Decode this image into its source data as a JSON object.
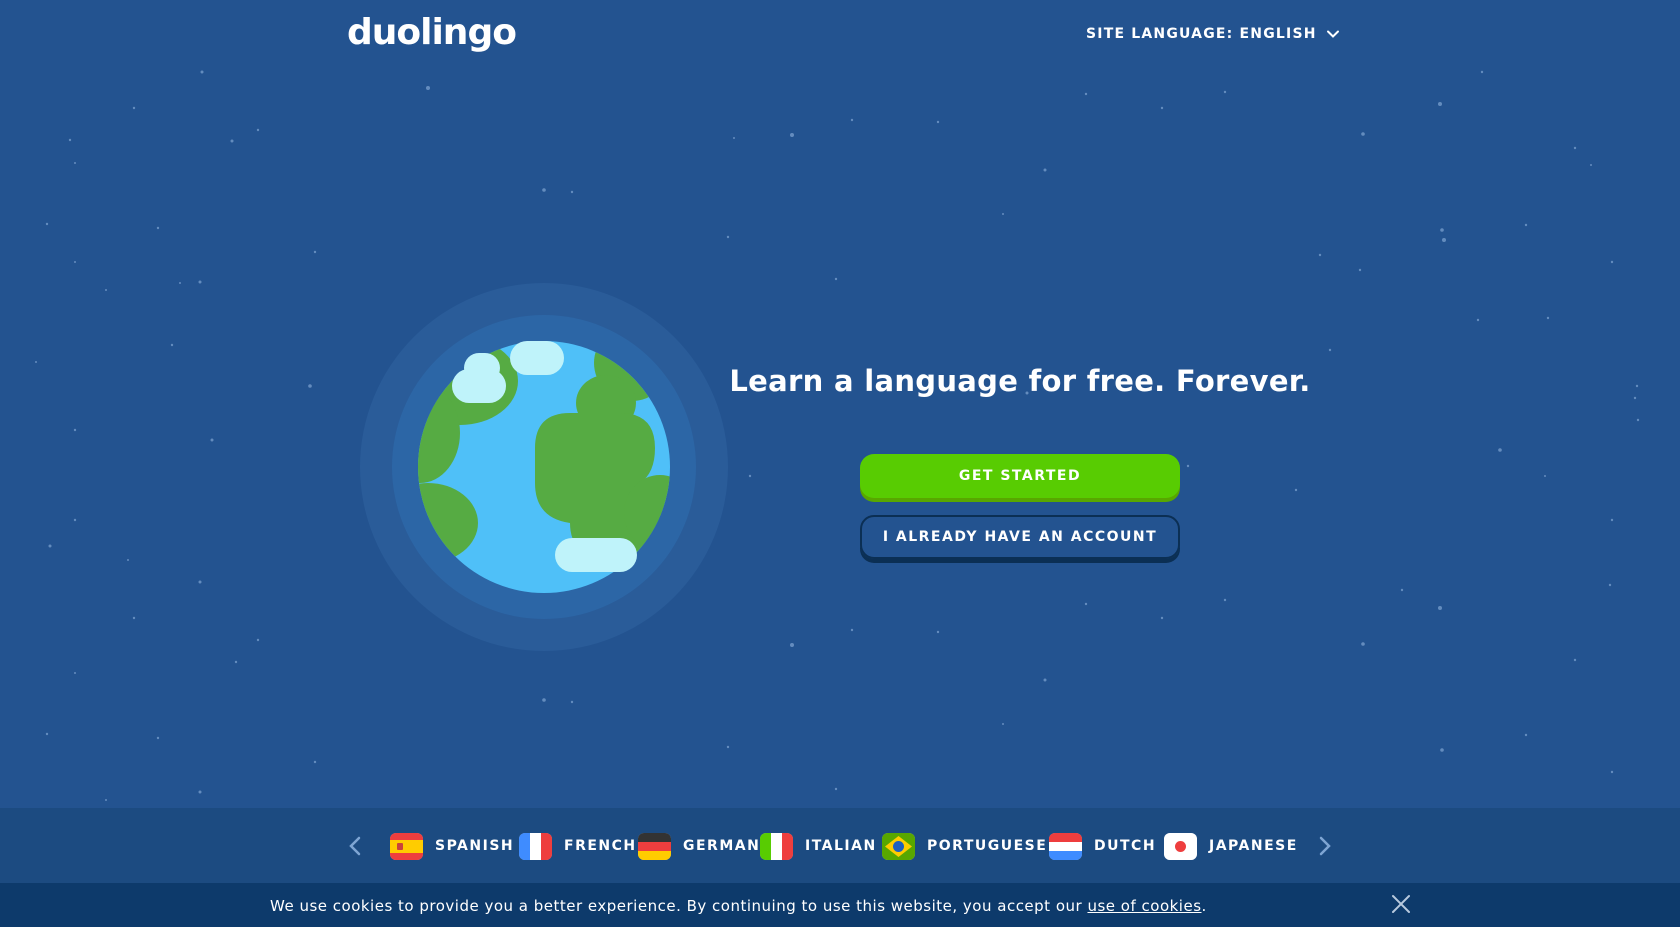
{
  "header": {
    "logo": "duolingo",
    "site_language_label": "SITE LANGUAGE: ENGLISH",
    "chevron_icon": "chevron-down-icon"
  },
  "hero": {
    "title": "Learn a language for free. Forever.",
    "get_started": "GET STARTED",
    "have_account": "I ALREADY HAVE AN ACCOUNT",
    "illustration_icon": "globe-illustration"
  },
  "languages": {
    "prev_icon": "chevron-left-icon",
    "next_icon": "chevron-right-icon",
    "items": [
      {
        "label": "SPANISH",
        "flag": "spain-flag-icon"
      },
      {
        "label": "FRENCH",
        "flag": "france-flag-icon"
      },
      {
        "label": "GERMAN",
        "flag": "germany-flag-icon"
      },
      {
        "label": "ITALIAN",
        "flag": "italy-flag-icon"
      },
      {
        "label": "PORTUGUESE",
        "flag": "brazil-flag-icon"
      },
      {
        "label": "DUTCH",
        "flag": "netherlands-flag-icon"
      },
      {
        "label": "JAPANESE",
        "flag": "japan-flag-icon"
      }
    ]
  },
  "cookie_banner": {
    "text": "We use cookies to provide you a better experience. By continuing to use this website, you accept our ",
    "link": "use of cookies",
    "suffix": ".",
    "close_icon": "close-icon"
  },
  "colors": {
    "background": "#235390",
    "primary_button": "#58cc02",
    "language_bar": "#1c4b81",
    "cookie_bar": "#0d3a6b"
  }
}
